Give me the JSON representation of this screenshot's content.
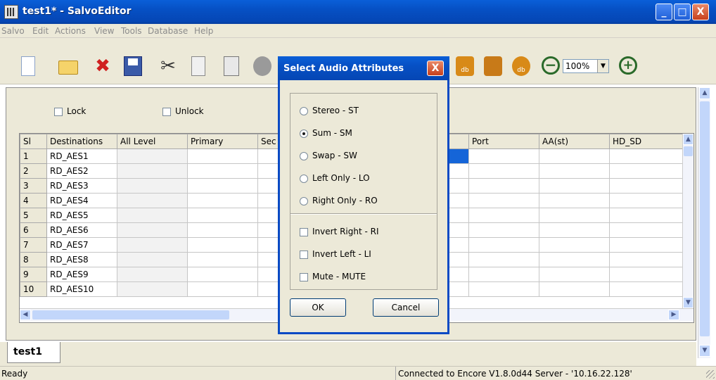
{
  "window": {
    "title": "test1* - SalvoEditor",
    "minimize": "_",
    "maximize": "□",
    "close": "X"
  },
  "menu": [
    "Salvo",
    "Edit",
    "Actions",
    "View",
    "Tools",
    "Database",
    "Help"
  ],
  "toolbar": {
    "zoom": "100%",
    "dropdown_arrow": "▼",
    "db_label": "db"
  },
  "options": {
    "lock": "Lock",
    "unlock": "Unlock"
  },
  "grid": {
    "columns": [
      "Sl",
      "Destinations",
      "All Level",
      "Primary",
      "Sec",
      "",
      "",
      "Port",
      "AA(st)",
      "HD_SD"
    ],
    "rows": [
      [
        "1",
        "RD_AES1"
      ],
      [
        "2",
        "RD_AES2"
      ],
      [
        "3",
        "RD_AES3"
      ],
      [
        "4",
        "RD_AES4"
      ],
      [
        "5",
        "RD_AES5"
      ],
      [
        "6",
        "RD_AES6"
      ],
      [
        "7",
        "RD_AES7"
      ],
      [
        "8",
        "RD_AES8"
      ],
      [
        "9",
        "RD_AES9"
      ],
      [
        "10",
        "RD_AES10"
      ]
    ],
    "scroll_up": "▲",
    "scroll_down": "▼",
    "scroll_left": "◀",
    "scroll_right": "▶"
  },
  "tab": {
    "label": "test1"
  },
  "status": {
    "left": "Ready",
    "right": "Connected to Encore V1.8.0d44 Server - '10.16.22.128'"
  },
  "dialog": {
    "title": "Select Audio Attributes",
    "close": "X",
    "radios": [
      {
        "label": "Stereo - ST",
        "selected": false
      },
      {
        "label": "Sum - SM",
        "selected": true
      },
      {
        "label": "Swap - SW",
        "selected": false
      },
      {
        "label": "Left Only - LO",
        "selected": false
      },
      {
        "label": "Right Only - RO",
        "selected": false
      }
    ],
    "checkboxes": [
      "Invert Right - RI",
      "Invert Left - LI",
      "Mute - MUTE"
    ],
    "ok": "OK",
    "cancel": "Cancel"
  }
}
